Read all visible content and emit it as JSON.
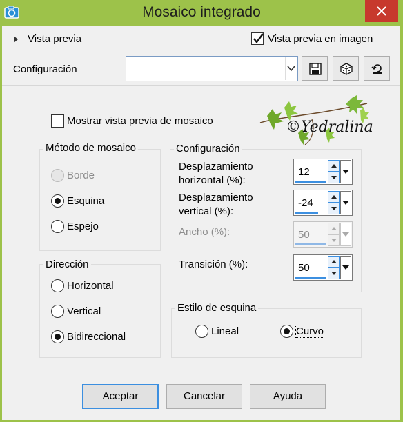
{
  "window": {
    "title": "Mosaico integrado",
    "icon": "camera-icon",
    "close_icon": "close-icon",
    "accent_color": "#9dc24a",
    "close_color": "#c7392d"
  },
  "preview_row": {
    "toggle_label": "Vista previa",
    "image_preview_label": "Vista previa en imagen",
    "image_preview_checked": true
  },
  "config_row": {
    "label": "Configuración",
    "combo_value": "",
    "buttons": [
      "save-icon",
      "dice-icon",
      "reset-icon"
    ]
  },
  "tile_preview": {
    "label": "Mostrar vista previa de mosaico",
    "checked": false
  },
  "watermark": {
    "text": "©Yedralina"
  },
  "method_group": {
    "title": "Método de mosaico",
    "options": [
      {
        "label": "Borde",
        "selected": false,
        "enabled": false
      },
      {
        "label": "Esquina",
        "selected": true,
        "enabled": true
      },
      {
        "label": "Espejo",
        "selected": false,
        "enabled": true
      }
    ]
  },
  "direction_group": {
    "title": "Dirección",
    "options": [
      {
        "label": "Horizontal",
        "selected": false
      },
      {
        "label": "Vertical",
        "selected": false
      },
      {
        "label": "Bidireccional",
        "selected": true
      }
    ]
  },
  "settings_group": {
    "title": "Configuración",
    "fields": [
      {
        "label_line1": "Desplazamiento",
        "label_line2": "horizontal (%):",
        "value": "12",
        "enabled": true
      },
      {
        "label_line1": "Desplazamiento",
        "label_line2": "vertical (%):",
        "value": "-24",
        "enabled": true
      },
      {
        "label_line1": "Ancho (%):",
        "label_line2": "",
        "value": "50",
        "enabled": false
      },
      {
        "label_line1": "Transición (%):",
        "label_line2": "",
        "value": "50",
        "enabled": true
      }
    ]
  },
  "corner_group": {
    "title": "Estilo de esquina",
    "options": [
      {
        "label": "Lineal",
        "selected": false
      },
      {
        "label": "Curvo",
        "selected": true
      }
    ]
  },
  "buttons": {
    "ok": "Aceptar",
    "cancel": "Cancelar",
    "help": "Ayuda"
  }
}
